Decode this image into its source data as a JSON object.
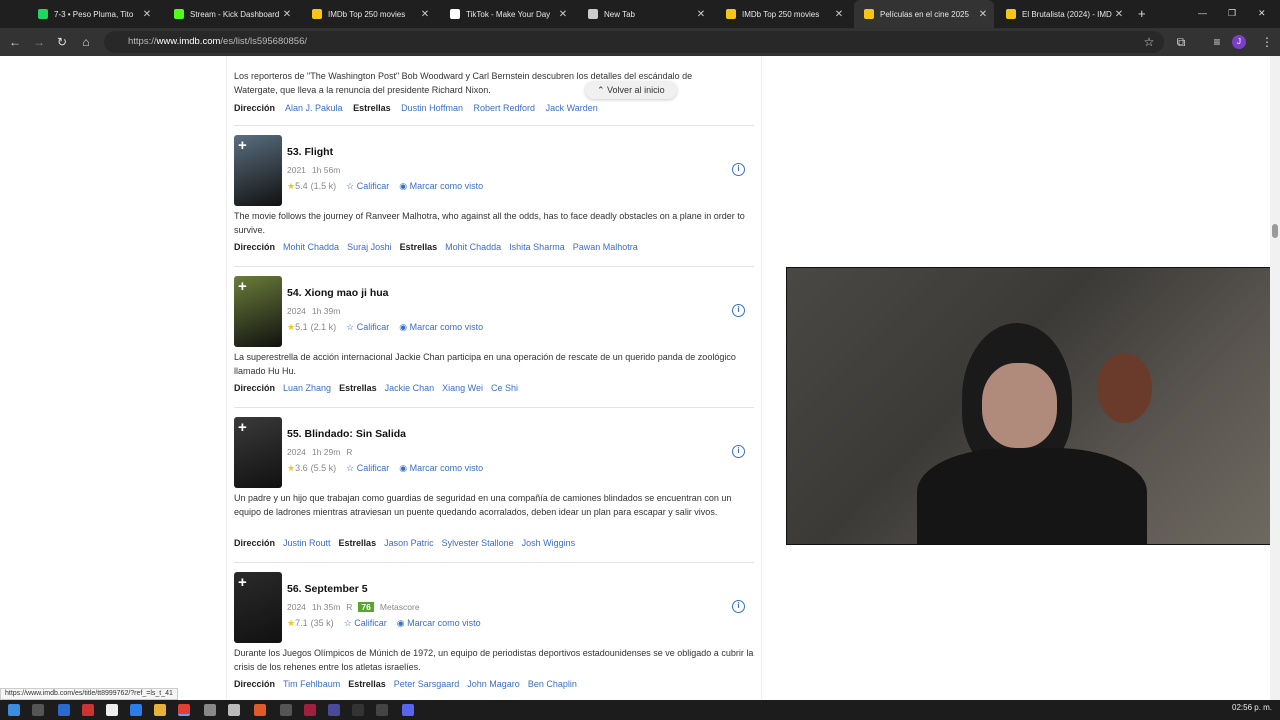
{
  "browser": {
    "tabs": [
      {
        "title": "7-3 • Peso Pluma, Tito",
        "favicon_color": "#1ed760",
        "active": false
      },
      {
        "title": "Stream - Kick Dashboard",
        "favicon_color": "#53fc18",
        "active": false
      },
      {
        "title": "IMDb Top 250 movies",
        "favicon_color": "#f5c518",
        "active": false
      },
      {
        "title": "TikTok - Make Your Day",
        "favicon_color": "#ffffff",
        "active": false
      },
      {
        "title": "New Tab",
        "favicon_color": "#cccccc",
        "active": false
      },
      {
        "title": "IMDb Top 250 movies",
        "favicon_color": "#f5c518",
        "active": false
      },
      {
        "title": "Películas en el cine 2025",
        "favicon_color": "#f5c518",
        "active": true
      },
      {
        "title": "El Brutalista (2024) - IMDb",
        "favicon_color": "#f5c518",
        "active": false
      }
    ],
    "new_tab_label": "+",
    "url_prefix": "https://",
    "url_domain": "www.imdb.com",
    "url_path": "/es/list/ls595680856/",
    "profile_initial": "J"
  },
  "prev_item": {
    "description": "Los reporteros de \"The Washington Post\" Bob Woodward y Carl Bernstein descubren los detalles del escándalo de Watergate, que lleva a la renuncia del presidente Richard Nixon.",
    "direction_label": "Dirección",
    "directors": [
      "Alan J. Pakula"
    ],
    "stars_label": "Estrellas",
    "stars": [
      "Dustin Hoffman",
      "Robert Redford",
      "Jack Warden"
    ]
  },
  "back_to_top": "Volver al inicio",
  "movies": [
    {
      "title": "53. Flight",
      "year": "2021",
      "runtime": "1h 56m",
      "rating_cert": "",
      "metascore": "",
      "metascore_label": "",
      "rating": "5.4",
      "votes": "(1.5 k)",
      "rate_label": "Calificar",
      "watched_label": "Marcar como visto",
      "description": "The movie follows the journey of Ranveer Malhotra, who against all the odds, has to face deadly obstacles on a plane in order to survive.",
      "direction_label": "Dirección",
      "directors": [
        "Mohit Chadda",
        "Suraj Joshi"
      ],
      "stars_label": "Estrellas",
      "stars": [
        "Mohit Chadda",
        "Ishita Sharma",
        "Pawan Malhotra"
      ],
      "poster_color": "#5a6f80"
    },
    {
      "title": "54. Xiong mao ji hua",
      "year": "2024",
      "runtime": "1h 39m",
      "rating_cert": "",
      "metascore": "",
      "metascore_label": "",
      "rating": "5.1",
      "votes": "(2.1 k)",
      "rate_label": "Calificar",
      "watched_label": "Marcar como visto",
      "description": "La superestrella de acción internacional Jackie Chan participa en una operación de rescate de un querido panda de zoológico llamado Hu Hu.",
      "direction_label": "Dirección",
      "directors": [
        "Luan Zhang"
      ],
      "stars_label": "Estrellas",
      "stars": [
        "Jackie Chan",
        "Xiang Wei",
        "Ce Shi"
      ],
      "poster_color": "#6b7d3a"
    },
    {
      "title": "55. Blindado: Sin Salida",
      "year": "2024",
      "runtime": "1h 29m",
      "rating_cert": "R",
      "metascore": "",
      "metascore_label": "",
      "rating": "3.6",
      "votes": "(5.5 k)",
      "rate_label": "Calificar",
      "watched_label": "Marcar como visto",
      "description": "Un padre y un hijo que trabajan como guardias de seguridad en una compañía de camiones blindados se encuentran con un equipo de ladrones mientras atraviesan un puente quedando acorralados, deben idear un plan para escapar y salir vivos.",
      "direction_label": "Dirección",
      "directors": [
        "Justin Routt"
      ],
      "stars_label": "Estrellas",
      "stars": [
        "Jason Patric",
        "Sylvester Stallone",
        "Josh Wiggins"
      ],
      "poster_color": "#3a3a3a"
    },
    {
      "title": "56. September 5",
      "year": "2024",
      "runtime": "1h 35m",
      "rating_cert": "R",
      "metascore": "76",
      "metascore_label": "Metascore",
      "rating": "7.1",
      "votes": "(35 k)",
      "rate_label": "Calificar",
      "watched_label": "Marcar como visto",
      "description": "Durante los Juegos Olímpicos de Múnich de 1972, un equipo de periodistas deportivos estadounidenses se ve obligado a cubrir la crisis de los rehenes entre los atletas israelíes.",
      "direction_label": "Dirección",
      "directors": [
        "Tim Fehlbaum"
      ],
      "stars_label": "Estrellas",
      "stars": [
        "Peter Sarsgaard",
        "John Magaro",
        "Ben Chaplin"
      ],
      "poster_color": "#2a2a2a"
    }
  ],
  "status_url": "https://www.imdb.com/es/title/tt8999762/?ref_=ls_t_41",
  "clock": "02:56 p. m."
}
